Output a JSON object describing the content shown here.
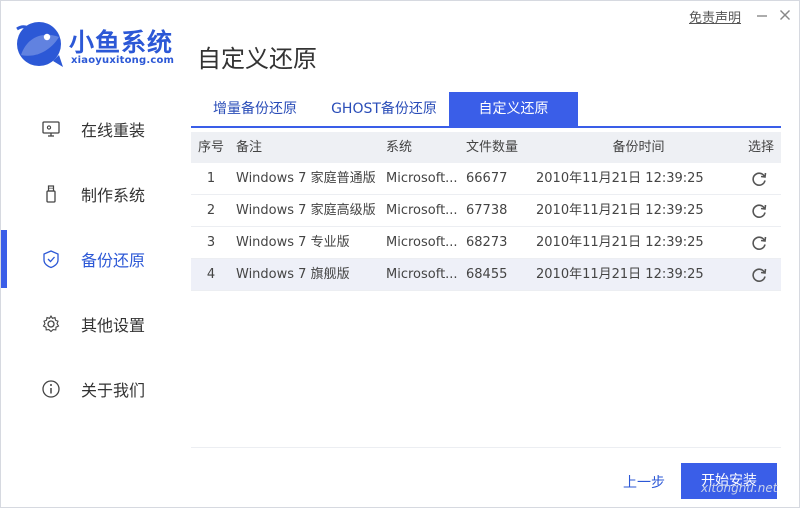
{
  "brand": {
    "name": "小鱼系统",
    "domain": "xiaoyuxitong.com",
    "color": "#2c58d6"
  },
  "page_title": "自定义还原",
  "titlebar": {
    "disclaimer": "免责声明",
    "minimize_icon": "minimize-icon",
    "close_icon": "close-icon"
  },
  "sidebar": {
    "items": [
      {
        "label": "在线重装",
        "icon": "monitor-icon",
        "active": false
      },
      {
        "label": "制作系统",
        "icon": "usb-icon",
        "active": false
      },
      {
        "label": "备份还原",
        "icon": "backup-restore-icon",
        "active": true
      },
      {
        "label": "其他设置",
        "icon": "gear-icon",
        "active": false
      },
      {
        "label": "关于我们",
        "icon": "info-icon",
        "active": false
      }
    ]
  },
  "tabs": [
    {
      "label": "增量备份还原",
      "active": false
    },
    {
      "label": "GHOST备份还原",
      "active": false
    },
    {
      "label": "自定义还原",
      "active": true
    }
  ],
  "table": {
    "headers": {
      "index": "序号",
      "note": "备注",
      "system": "系统",
      "file_count": "文件数量",
      "backup_time": "备份时间",
      "select": "选择"
    },
    "rows": [
      {
        "index": "1",
        "note": "Windows 7 家庭普通版",
        "system": "Microsoft...",
        "file_count": "66677",
        "backup_time": "2010年11月21日 12:39:25",
        "selected": false
      },
      {
        "index": "2",
        "note": "Windows 7 家庭高级版",
        "system": "Microsoft...",
        "file_count": "67738",
        "backup_time": "2010年11月21日 12:39:25",
        "selected": false
      },
      {
        "index": "3",
        "note": "Windows 7 专业版",
        "system": "Microsoft...",
        "file_count": "68273",
        "backup_time": "2010年11月21日 12:39:25",
        "selected": false
      },
      {
        "index": "4",
        "note": "Windows 7 旗舰版",
        "system": "Microsoft...",
        "file_count": "68455",
        "backup_time": "2010年11月21日 12:39:25",
        "selected": true
      }
    ]
  },
  "buttons": {
    "prev": "上一步",
    "start": "开始安装"
  },
  "watermark": "xitonghu.net",
  "colors": {
    "accent": "#3a5ee8",
    "header_bg": "#eef0f4"
  }
}
